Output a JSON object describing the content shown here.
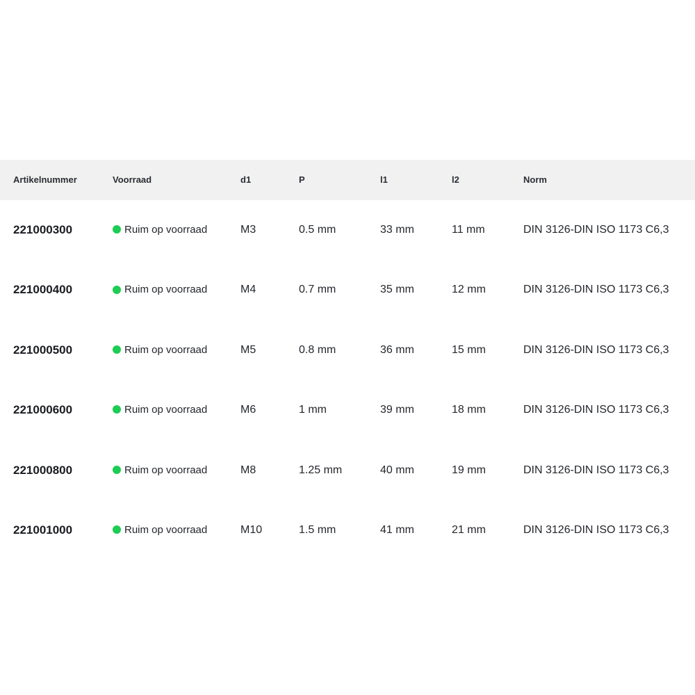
{
  "table": {
    "headers": {
      "article": "Artikelnummer",
      "stock": "Voorraad",
      "d1": "d1",
      "p": "P",
      "l1": "l1",
      "l2": "l2",
      "norm": "Norm"
    },
    "stock_dot_color": "#1dcc52",
    "rows": [
      {
        "article": "221000300",
        "stock": "Ruim op voorraad",
        "d1": "M3",
        "p": "0.5 mm",
        "l1": "33 mm",
        "l2": "11 mm",
        "norm": "DIN 3126-DIN ISO 1173 C6,3"
      },
      {
        "article": "221000400",
        "stock": "Ruim op voorraad",
        "d1": "M4",
        "p": "0.7 mm",
        "l1": "35 mm",
        "l2": "12 mm",
        "norm": "DIN 3126-DIN ISO 1173 C6,3"
      },
      {
        "article": "221000500",
        "stock": "Ruim op voorraad",
        "d1": "M5",
        "p": "0.8 mm",
        "l1": "36 mm",
        "l2": "15 mm",
        "norm": "DIN 3126-DIN ISO 1173 C6,3"
      },
      {
        "article": "221000600",
        "stock": "Ruim op voorraad",
        "d1": "M6",
        "p": "1 mm",
        "l1": "39 mm",
        "l2": "18 mm",
        "norm": "DIN 3126-DIN ISO 1173 C6,3"
      },
      {
        "article": "221000800",
        "stock": "Ruim op voorraad",
        "d1": "M8",
        "p": "1.25 mm",
        "l1": "40 mm",
        "l2": "19 mm",
        "norm": "DIN 3126-DIN ISO 1173 C6,3"
      },
      {
        "article": "221001000",
        "stock": "Ruim op voorraad",
        "d1": "M10",
        "p": "1.5 mm",
        "l1": "41 mm",
        "l2": "21 mm",
        "norm": "DIN 3126-DIN ISO 1173 C6,3"
      }
    ]
  }
}
